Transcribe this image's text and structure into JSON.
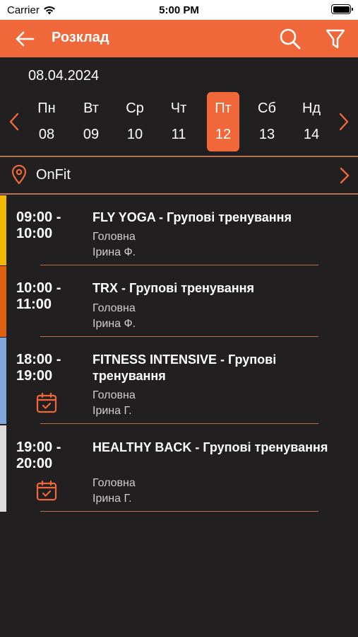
{
  "status_bar": {
    "carrier": "Carrier",
    "time": "5:00 PM"
  },
  "header": {
    "title": "Розклад",
    "accent_color": "#f0683a"
  },
  "selected_date": "08.04.2024",
  "week": [
    {
      "name": "Пн",
      "num": "08",
      "active": false
    },
    {
      "name": "Вт",
      "num": "09",
      "active": false
    },
    {
      "name": "Ср",
      "num": "10",
      "active": false
    },
    {
      "name": "Чт",
      "num": "11",
      "active": false
    },
    {
      "name": "Пт",
      "num": "12",
      "active": true
    },
    {
      "name": "Сб",
      "num": "13",
      "active": false
    },
    {
      "name": "Нд",
      "num": "14",
      "active": false
    }
  ],
  "location": {
    "name": "OnFit"
  },
  "sessions": [
    {
      "start": "09:00 -",
      "end": "10:00",
      "title": "FLY YOGA - Групові тренування",
      "room": "Головна",
      "trainer": "Ірина Ф.",
      "color": "#f5b800",
      "booked": false
    },
    {
      "start": "10:00 -",
      "end": "11:00",
      "title": "TRX - Групові тренування",
      "room": "Головна",
      "trainer": "Ірина Ф.",
      "color": "#e0600e",
      "booked": false
    },
    {
      "start": "18:00 -",
      "end": "19:00",
      "title": "FITNESS INTENSIVE - Групові тренування",
      "room": "Головна",
      "trainer": "Ірина Г.",
      "color": "#7fa8dc",
      "booked": true
    },
    {
      "start": "19:00 -",
      "end": "20:00",
      "title": "HEALTHY BACK - Групові тренування",
      "room": "Головна",
      "trainer": "Ірина Г.",
      "color": "#dcdcdc",
      "booked": true
    }
  ]
}
